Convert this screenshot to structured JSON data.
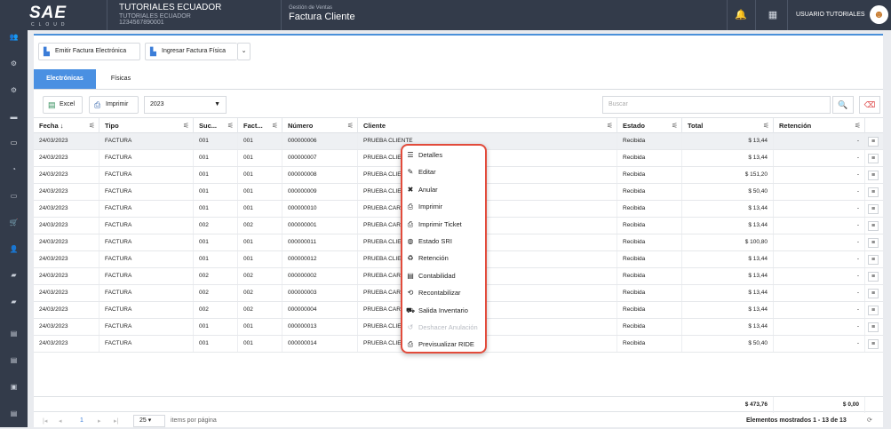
{
  "topbar": {
    "logo_big": "SAE",
    "logo_small": "CLOUD",
    "company_name": "TUTORIALES ECUADOR",
    "company_sub1": "TUTORIALES ECUADOR",
    "company_ruc": "1234567890001",
    "module_parent": "Gestión de Ventas",
    "module_title": "Factura Cliente",
    "user": "USUARIO TUTORIALES"
  },
  "toolbar": {
    "emit_label": "Emitir Factura Electrónica",
    "physical_label": "Ingresar Factura Física",
    "dropdown_caret": "⌄"
  },
  "tabs": [
    {
      "label": "Electrónicas",
      "active": true
    },
    {
      "label": "Físicas",
      "active": false
    }
  ],
  "subtoolbar": {
    "excel_label": "Excel",
    "print_label": "Imprimir",
    "year": "2023",
    "search_placeholder": "Buscar"
  },
  "columns": [
    "Fecha ↓",
    "Tipo",
    "Suc...",
    "Fact...",
    "Número",
    "Cliente",
    "Estado",
    "Total",
    "Retención"
  ],
  "rows": [
    {
      "fecha": "24/03/2023",
      "tipo": "FACTURA",
      "suc": "001",
      "fact": "001",
      "numero": "000000006",
      "cliente": "PRUEBA CLIENTE",
      "estado": "Recibida",
      "total": "$ 13,44",
      "ret": "-"
    },
    {
      "fecha": "24/03/2023",
      "tipo": "FACTURA",
      "suc": "001",
      "fact": "001",
      "numero": "000000007",
      "cliente": "PRUEBA CLIE",
      "estado": "Recibida",
      "total": "$ 13,44",
      "ret": "-"
    },
    {
      "fecha": "24/03/2023",
      "tipo": "FACTURA",
      "suc": "001",
      "fact": "001",
      "numero": "000000008",
      "cliente": "PRUEBA CLIE",
      "estado": "Recibida",
      "total": "$ 151,20",
      "ret": "-"
    },
    {
      "fecha": "24/03/2023",
      "tipo": "FACTURA",
      "suc": "001",
      "fact": "001",
      "numero": "000000009",
      "cliente": "PRUEBA CLIE",
      "estado": "Recibida",
      "total": "$ 50,40",
      "ret": "-"
    },
    {
      "fecha": "24/03/2023",
      "tipo": "FACTURA",
      "suc": "001",
      "fact": "001",
      "numero": "000000010",
      "cliente": "PRUEBA CARC",
      "estado": "Recibida",
      "total": "$ 13,44",
      "ret": "-"
    },
    {
      "fecha": "24/03/2023",
      "tipo": "FACTURA",
      "suc": "002",
      "fact": "002",
      "numero": "000000001",
      "cliente": "PRUEBA CARC",
      "estado": "Recibida",
      "total": "$ 13,44",
      "ret": "-"
    },
    {
      "fecha": "24/03/2023",
      "tipo": "FACTURA",
      "suc": "001",
      "fact": "001",
      "numero": "000000011",
      "cliente": "PRUEBA CLIE",
      "estado": "Recibida",
      "total": "$ 100,80",
      "ret": "-"
    },
    {
      "fecha": "24/03/2023",
      "tipo": "FACTURA",
      "suc": "001",
      "fact": "001",
      "numero": "000000012",
      "cliente": "PRUEBA CLIE",
      "estado": "Recibida",
      "total": "$ 13,44",
      "ret": "-"
    },
    {
      "fecha": "24/03/2023",
      "tipo": "FACTURA",
      "suc": "002",
      "fact": "002",
      "numero": "000000002",
      "cliente": "PRUEBA CARC",
      "estado": "Recibida",
      "total": "$ 13,44",
      "ret": "-"
    },
    {
      "fecha": "24/03/2023",
      "tipo": "FACTURA",
      "suc": "002",
      "fact": "002",
      "numero": "000000003",
      "cliente": "PRUEBA CARC",
      "estado": "Recibida",
      "total": "$ 13,44",
      "ret": "-"
    },
    {
      "fecha": "24/03/2023",
      "tipo": "FACTURA",
      "suc": "002",
      "fact": "002",
      "numero": "000000004",
      "cliente": "PRUEBA CARC",
      "estado": "Recibida",
      "total": "$ 13,44",
      "ret": "-"
    },
    {
      "fecha": "24/03/2023",
      "tipo": "FACTURA",
      "suc": "001",
      "fact": "001",
      "numero": "000000013",
      "cliente": "PRUEBA CLIE",
      "estado": "Recibida",
      "total": "$ 13,44",
      "ret": "-"
    },
    {
      "fecha": "24/03/2023",
      "tipo": "FACTURA",
      "suc": "001",
      "fact": "001",
      "numero": "000000014",
      "cliente": "PRUEBA CLIE",
      "estado": "Recibida",
      "total": "$ 50,40",
      "ret": "-"
    }
  ],
  "totals": {
    "total": "$ 473,76",
    "retencion": "$ 0,00"
  },
  "pager": {
    "page": "1",
    "page_size": "25",
    "per_page_label": "items por página",
    "shown": "Elementos mostrados 1 - 13 de 13"
  },
  "context_menu": [
    {
      "label": "Detalles",
      "icon": "list-icon",
      "glyph": "☰",
      "disabled": false
    },
    {
      "label": "Editar",
      "icon": "pencil-icon",
      "glyph": "✎",
      "disabled": false
    },
    {
      "label": "Anular",
      "icon": "x-icon",
      "glyph": "✖",
      "disabled": false
    },
    {
      "label": "Imprimir",
      "icon": "printer-icon",
      "glyph": "⎙",
      "disabled": false
    },
    {
      "label": "Imprimir Ticket",
      "icon": "printer-icon",
      "glyph": "⎙",
      "disabled": false
    },
    {
      "label": "Estado SRI",
      "icon": "globe-icon",
      "glyph": "◍",
      "disabled": false
    },
    {
      "label": "Retención",
      "icon": "recycle-icon",
      "glyph": "♻",
      "disabled": false
    },
    {
      "label": "Contabilidad",
      "icon": "book-icon",
      "glyph": "▤",
      "disabled": false
    },
    {
      "label": "Recontabilizar",
      "icon": "refresh-icon",
      "glyph": "⟲",
      "disabled": false
    },
    {
      "label": "Salida Inventario",
      "icon": "truck-icon",
      "glyph": "⛟",
      "disabled": false
    },
    {
      "label": "Deshacer Anulación",
      "icon": "undo-icon",
      "glyph": "↺",
      "disabled": true
    },
    {
      "label": "Previsualizar RIDE",
      "icon": "printer-icon",
      "glyph": "⎙",
      "disabled": false
    }
  ],
  "colors": {
    "accent": "#4a90e2",
    "topbar": "#333b4a",
    "menu_border": "#e24b3b"
  }
}
